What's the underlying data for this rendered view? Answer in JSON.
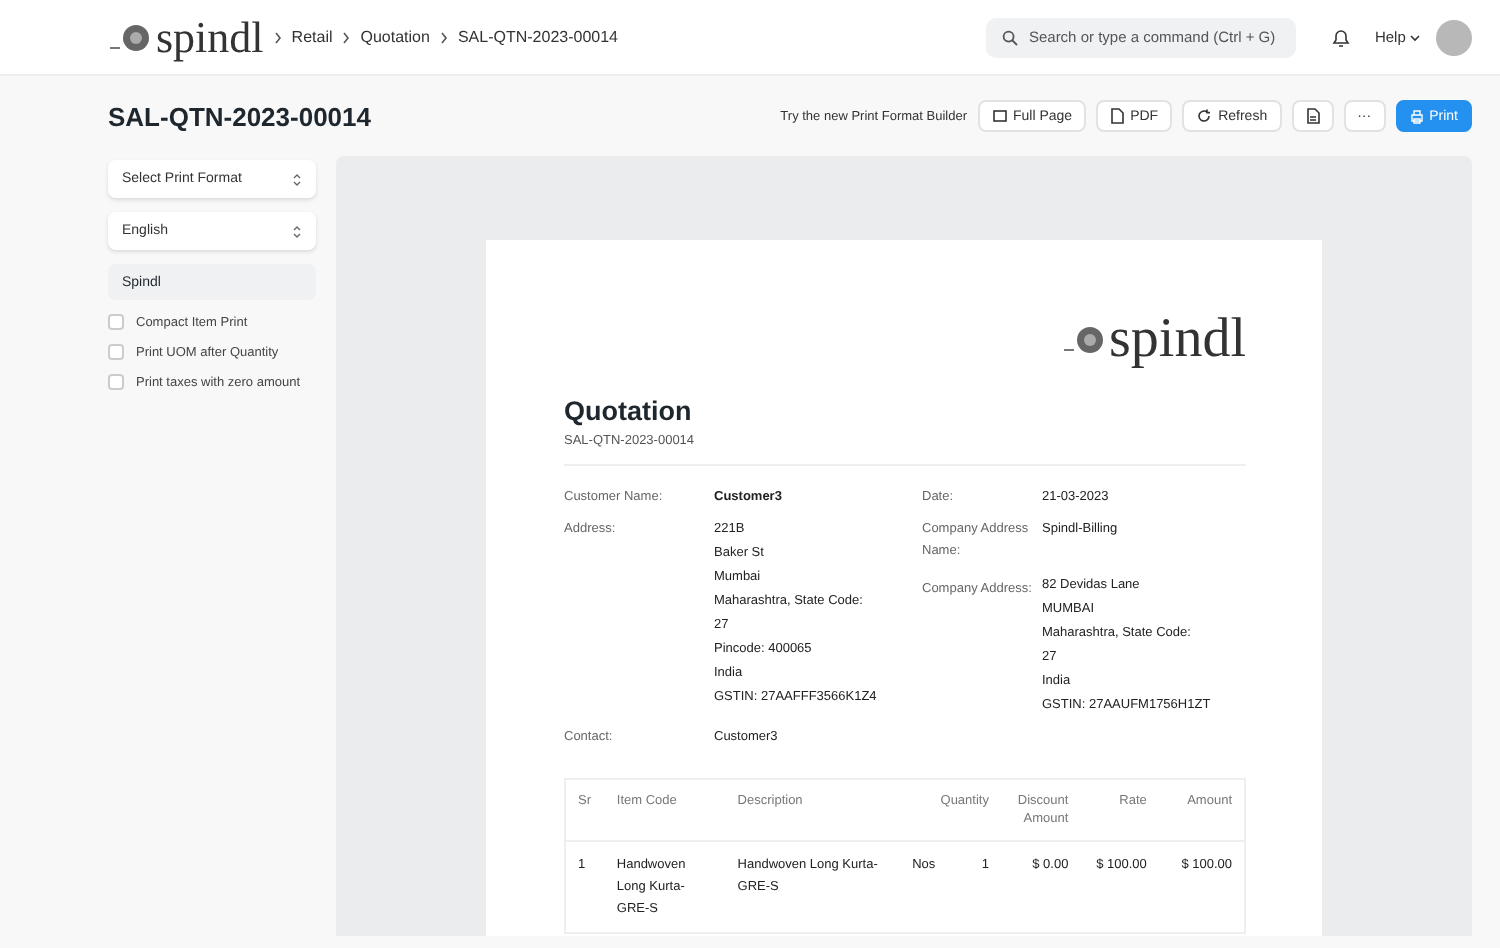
{
  "navbar": {
    "logo": "spindl",
    "breadcrumbs": [
      "Retail",
      "Quotation",
      "SAL-QTN-2023-00014"
    ],
    "search": {
      "placeholder": "Search or type a command (Ctrl + G)"
    },
    "help": "Help"
  },
  "page": {
    "title": "SAL-QTN-2023-00014",
    "hint": "Try the new Print Format Builder",
    "actions": [
      {
        "kind": "icon-text",
        "label": "Full Page",
        "primary": false
      },
      {
        "kind": "icon-text",
        "label": "PDF",
        "primary": false
      },
      {
        "kind": "icon-text",
        "label": "Refresh",
        "primary": false
      },
      {
        "kind": "icon",
        "primary": false
      },
      {
        "kind": "more",
        "label": "···",
        "primary": false
      },
      {
        "kind": "icon-text",
        "label": "Print",
        "primary": true
      }
    ]
  },
  "sidebar": {
    "selects": [
      {
        "value": "Select Print Format"
      },
      {
        "value": "English"
      }
    ],
    "letterhead": "Spindl",
    "options": [
      {
        "label": "Compact Item Print",
        "checked": false
      },
      {
        "label": "Print UOM after Quantity",
        "checked": false
      },
      {
        "label": "Print taxes with zero amount",
        "checked": false
      }
    ]
  },
  "document": {
    "logo": "spindl",
    "title": "Quotation",
    "number": "SAL-QTN-2023-00014",
    "fields": [
      {
        "label": "Customer Name:",
        "value": [
          "Customer3"
        ],
        "bold": true,
        "label2": "Date:",
        "value2": [
          "21-03-2023"
        ]
      },
      {
        "label": "Address:",
        "value": [
          "221B",
          "Baker St",
          "Mumbai",
          "Maharashtra, State Code:",
          "27",
          "Pincode: 400065",
          "India",
          "GSTIN: 27AAFFF3566K1Z4"
        ],
        "bold": false,
        "label2": "Company Address Name:",
        "value2": [
          "Spindl-Billing"
        ],
        "label3": "Company Address:",
        "value3": [
          "82 Devidas Lane",
          "MUMBAI",
          "Maharashtra, State Code:",
          "27",
          "India",
          "GSTIN: 27AAUFM1756H1ZT"
        ]
      },
      {
        "label": "Contact:",
        "value": [
          "Customer3"
        ],
        "bold": false
      }
    ],
    "items": {
      "columns": [
        "Sr",
        "Item Code",
        "Description",
        "Quantity",
        "Discount Amount",
        "Rate",
        "Amount"
      ],
      "rows": [
        {
          "sr": "1",
          "item_code": "Handwoven Long Kurta-GRE-S",
          "description": "Handwoven Long Kurta-GRE-S",
          "uom": "Nos",
          "quantity": "1",
          "discount": "$ 0.00",
          "rate": "$ 100.00",
          "amount": "$ 100.00"
        }
      ]
    }
  }
}
